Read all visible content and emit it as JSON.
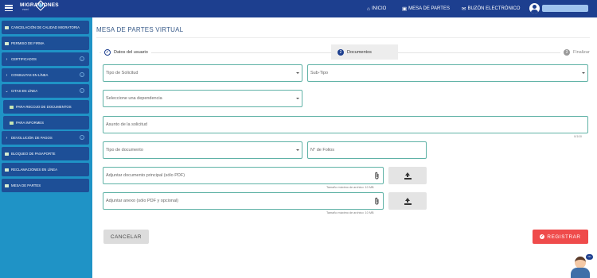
{
  "header": {
    "logo_text": "MIGRACIONES",
    "logo_sub": "PERÚ",
    "nav": [
      {
        "label": "INICIO",
        "icon": "home-icon"
      },
      {
        "label": "MESA DE PARTES",
        "icon": "briefcase-icon"
      },
      {
        "label": "BUZÓN ELECTRÓNICO",
        "icon": "envelope-icon"
      }
    ]
  },
  "sidebar": {
    "items": [
      {
        "label": "CANCELACIÓN DE CALIDAD MIGRATORIA",
        "icon": "folder-icon"
      },
      {
        "label": "PERMISO DE FIRMA",
        "icon": "folder-icon"
      },
      {
        "label": "CERTIFICADOS",
        "icon": "chevron-right-icon",
        "info": "i"
      },
      {
        "label": "CONSULTAS EN LÍNEA",
        "icon": "chevron-right-icon",
        "info": "i"
      },
      {
        "label": "CITAS EN LÍNEA",
        "icon": "chevron-down-icon",
        "info": "i"
      },
      {
        "label": "PARA RECOJO DE DOCUMENTOS",
        "icon": "folder-icon"
      },
      {
        "label": "PARA INFORMES",
        "icon": "folder-icon"
      },
      {
        "label": "DEVOLUCIÓN DE PAGOS",
        "icon": "chevron-right-icon",
        "info": "i"
      },
      {
        "label": "BLOQUEO DE PASAPORTE",
        "icon": "folder-icon"
      },
      {
        "label": "RECLAMACIONES EN LÍNEA",
        "icon": "folder-icon"
      },
      {
        "label": "MESA DE PARTES",
        "icon": "folder-icon"
      }
    ]
  },
  "main": {
    "title": "MESA DE PARTES VIRTUAL",
    "steps": [
      {
        "num": "✓",
        "label": "Datos del usuario"
      },
      {
        "num": "2",
        "label": "Documentos"
      },
      {
        "num": "3",
        "label": "Finalizar"
      }
    ],
    "form": {
      "tipo_solicitud": "Tipo de Solicitud",
      "subtipo": "Sub-Tipo",
      "dependencia": "Seleccione una dependencia",
      "asunto": "Asunto de la solicitud",
      "asunto_counter": "0/100",
      "tipo_documento": "Tipo de documento",
      "folios": "N° de Folios",
      "adjuntar_principal": "Adjuntar documento principal (sólo PDF)",
      "adjuntar_anexo": "Adjuntar anexo (sólo PDF y opcional)",
      "size_note_1": "Tamaño máximo de archivo: 10 MB",
      "size_note_2": "Tamaño máximo de archivo: 10 MB"
    },
    "buttons": {
      "cancel": "CANCELAR",
      "submit": "REGISTRAR"
    },
    "chat_badge": "•••"
  },
  "colors": {
    "header": "#1d3f8f",
    "sidebar": "#1f93c6",
    "sidebar_item": "#1d4f97",
    "field_border": "#5fb2a6",
    "submit": "#ef4b4b"
  }
}
